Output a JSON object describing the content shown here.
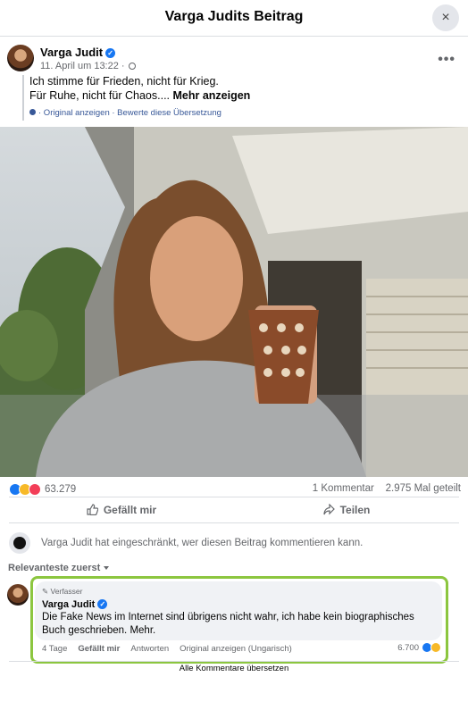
{
  "header": {
    "title": "Varga Judits Beitrag",
    "close_icon": "×"
  },
  "post": {
    "author": "Varga Judit",
    "date": "11. April um 13:22 ·",
    "text_line1": "Ich stimme für Frieden, nicht für Krieg.",
    "text_line2": "Für Ruhe, nicht für Chaos....",
    "more_label": "Mehr anzeigen",
    "translation_note": "· Original anzeigen · Bewerte diese Übersetzung"
  },
  "stats": {
    "reactions_count": "63.279",
    "comments": "1 Kommentar",
    "shares": "2.975 Mal geteilt",
    "reaction_icons": [
      "like",
      "haha",
      "love"
    ],
    "colors": {
      "like": "#1877f2",
      "haha": "#f7b928",
      "love": "#f33e58"
    }
  },
  "actions": {
    "like": "Gefällt mir",
    "share": "Teilen"
  },
  "restricted_notice": "Varga Judit hat eingeschränkt, wer diesen Beitrag kommentieren kann.",
  "sort_label": "Relevanteste zuerst",
  "comment": {
    "badge": "Verfasser",
    "author": "Varga Judit",
    "text": "Die Fake News im Internet sind übrigens nicht wahr, ich habe kein biographisches Buch geschrieben. Mehr.",
    "age": "4 Tage",
    "like": "Gefällt mir",
    "reply": "Antworten",
    "original": "Original anzeigen (Ungarisch)",
    "reactions_count": "6.700",
    "highlight_color": "#8cc63f"
  },
  "translate_all": "Alle Kommentare übersetzen"
}
